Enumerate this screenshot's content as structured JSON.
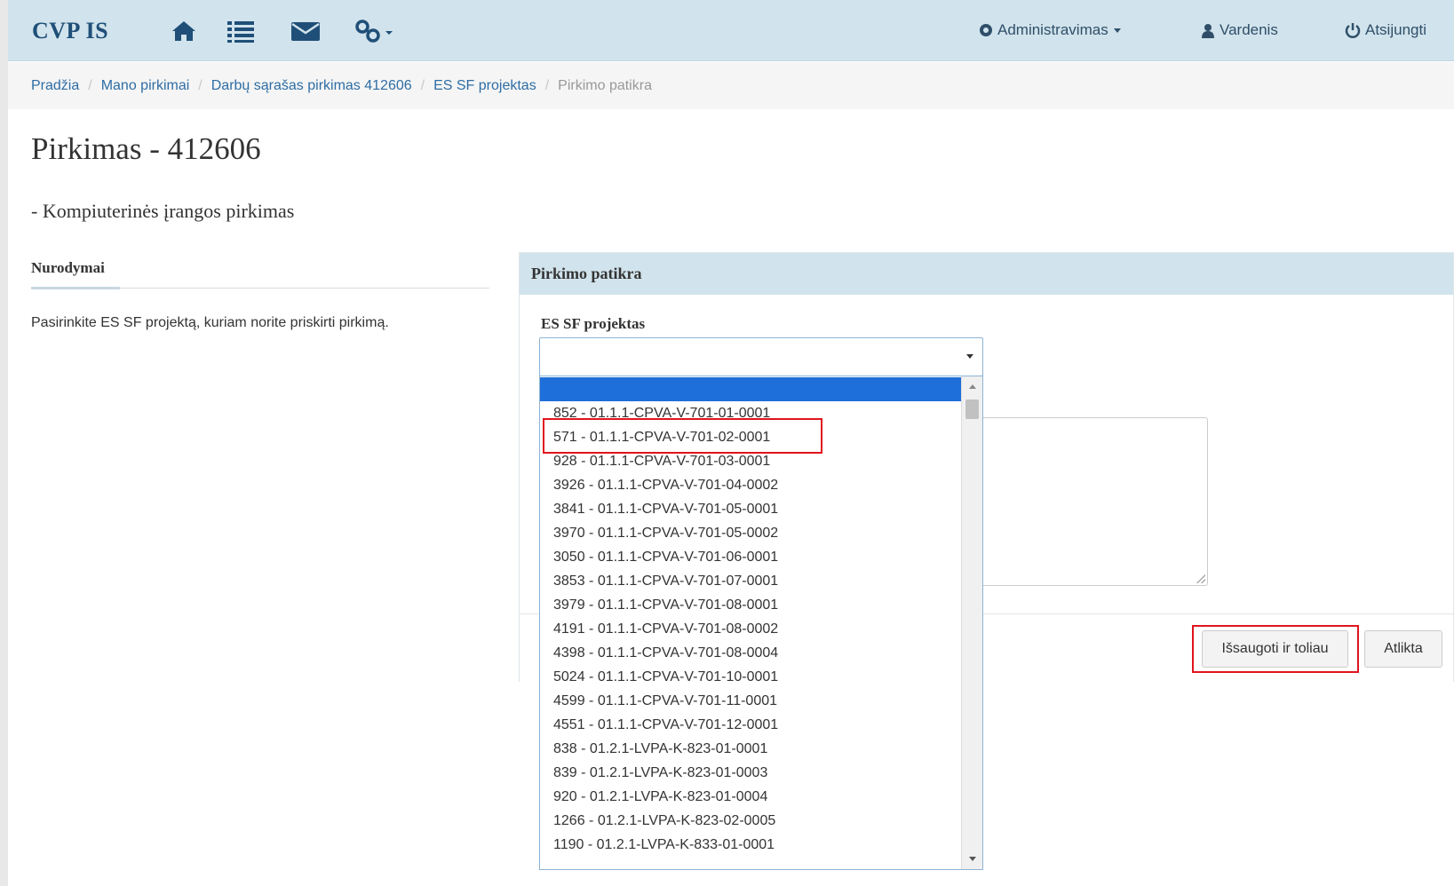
{
  "navbar": {
    "brand": "CVP IS",
    "admin_label": "Administravimas",
    "user_label": "Vardenis",
    "logout_label": "Atsijungti",
    "icons": [
      "home-icon",
      "list-icon",
      "envelope-icon",
      "link-icon"
    ]
  },
  "breadcrumb": {
    "items": [
      {
        "label": "Pradžia"
      },
      {
        "label": "Mano pirkimai"
      },
      {
        "label": "Darbų sąrašas pirkimas 412606"
      },
      {
        "label": "ES SF projektas"
      },
      {
        "label": "Pirkimo patikra"
      }
    ]
  },
  "page": {
    "title": "Pirkimas - 412606",
    "subtitle": "- Kompiuterinės įrangos pirkimas"
  },
  "instructions": {
    "heading": "Nurodymai",
    "text": "Pasirinkite ES SF projektą, kuriam norite priskirti pirkimą."
  },
  "panel": {
    "heading": "Pirkimo patikra",
    "field_label": "ES SF projektas",
    "select_value": ""
  },
  "dropdown": {
    "options": [
      "",
      "852 - 01.1.1-CPVA-V-701-01-0001",
      "571 - 01.1.1-CPVA-V-701-02-0001",
      "928 - 01.1.1-CPVA-V-701-03-0001",
      "3926 - 01.1.1-CPVA-V-701-04-0002",
      "3841 - 01.1.1-CPVA-V-701-05-0001",
      "3970 - 01.1.1-CPVA-V-701-05-0002",
      "3050 - 01.1.1-CPVA-V-701-06-0001",
      "3853 - 01.1.1-CPVA-V-701-07-0001",
      "3979 - 01.1.1-CPVA-V-701-08-0001",
      "4191 - 01.1.1-CPVA-V-701-08-0002",
      "4398 - 01.1.1-CPVA-V-701-08-0004",
      "5024 - 01.1.1-CPVA-V-701-10-0001",
      "4599 - 01.1.1-CPVA-V-701-11-0001",
      "4551 - 01.1.1-CPVA-V-701-12-0001",
      "838 - 01.2.1-LVPA-K-823-01-0001",
      "839 - 01.2.1-LVPA-K-823-01-0003",
      "920 - 01.2.1-LVPA-K-823-01-0004",
      "1266 - 01.2.1-LVPA-K-823-02-0005",
      "1190 - 01.2.1-LVPA-K-833-01-0001"
    ],
    "selected_index": 0,
    "highlighted_option": "571 - 01.1.1-CPVA-V-701-02-0001"
  },
  "buttons": {
    "save_label": "Išsaugoti ir toliau",
    "done_label": "Atlikta"
  },
  "colors": {
    "navbar_bg": "#d1e3ec",
    "brand": "#1f4f78",
    "selected_option": "#1e6fd9",
    "highlight_box": "#e0141e"
  }
}
